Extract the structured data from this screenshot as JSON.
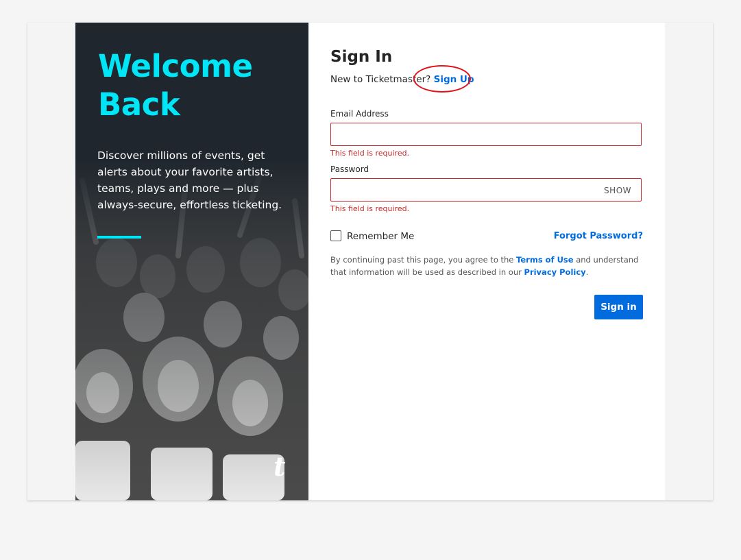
{
  "hero": {
    "title": "Welcome Back",
    "description": "Discover millions of events, get alerts about your favorite artists, teams, plays and more — plus always-secure, effortless ticketing.",
    "logo": "t",
    "accent_color": "#00e6f6"
  },
  "form": {
    "title": "Sign In",
    "new_prompt": "New to Ticketmaster?",
    "signup_link": "Sign Up",
    "email": {
      "label": "Email Address",
      "value": "",
      "error": "This field is required."
    },
    "password": {
      "label": "Password",
      "value": "",
      "error": "This field is required.",
      "show_label": "SHOW"
    },
    "remember_label": "Remember Me",
    "forgot_link": "Forgot Password?",
    "terms": {
      "prefix": "By continuing past this page, you agree to the",
      "terms_link": "Terms of Use",
      "middle": "and understand that information will be used as described in our",
      "privacy_link": "Privacy Policy",
      "suffix": "."
    },
    "submit_label": "Sign in",
    "link_color": "#026cdf",
    "error_color": "#c62828"
  }
}
